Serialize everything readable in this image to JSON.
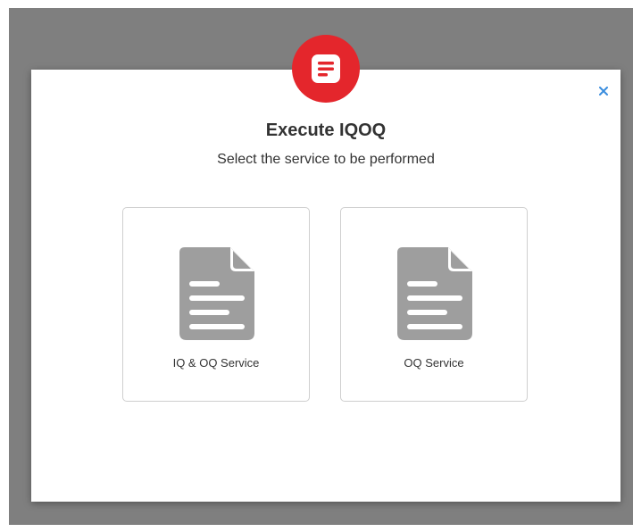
{
  "dialog": {
    "title": "Execute IQOQ",
    "subtitle": "Select the service to be performed",
    "header_icon": "document-list-icon",
    "close_icon": "close-icon",
    "accent_color": "#e4262c",
    "close_color": "#3a8dde"
  },
  "services": [
    {
      "label": "IQ & OQ Service",
      "icon": "document-icon"
    },
    {
      "label": "OQ Service",
      "icon": "document-icon"
    }
  ]
}
